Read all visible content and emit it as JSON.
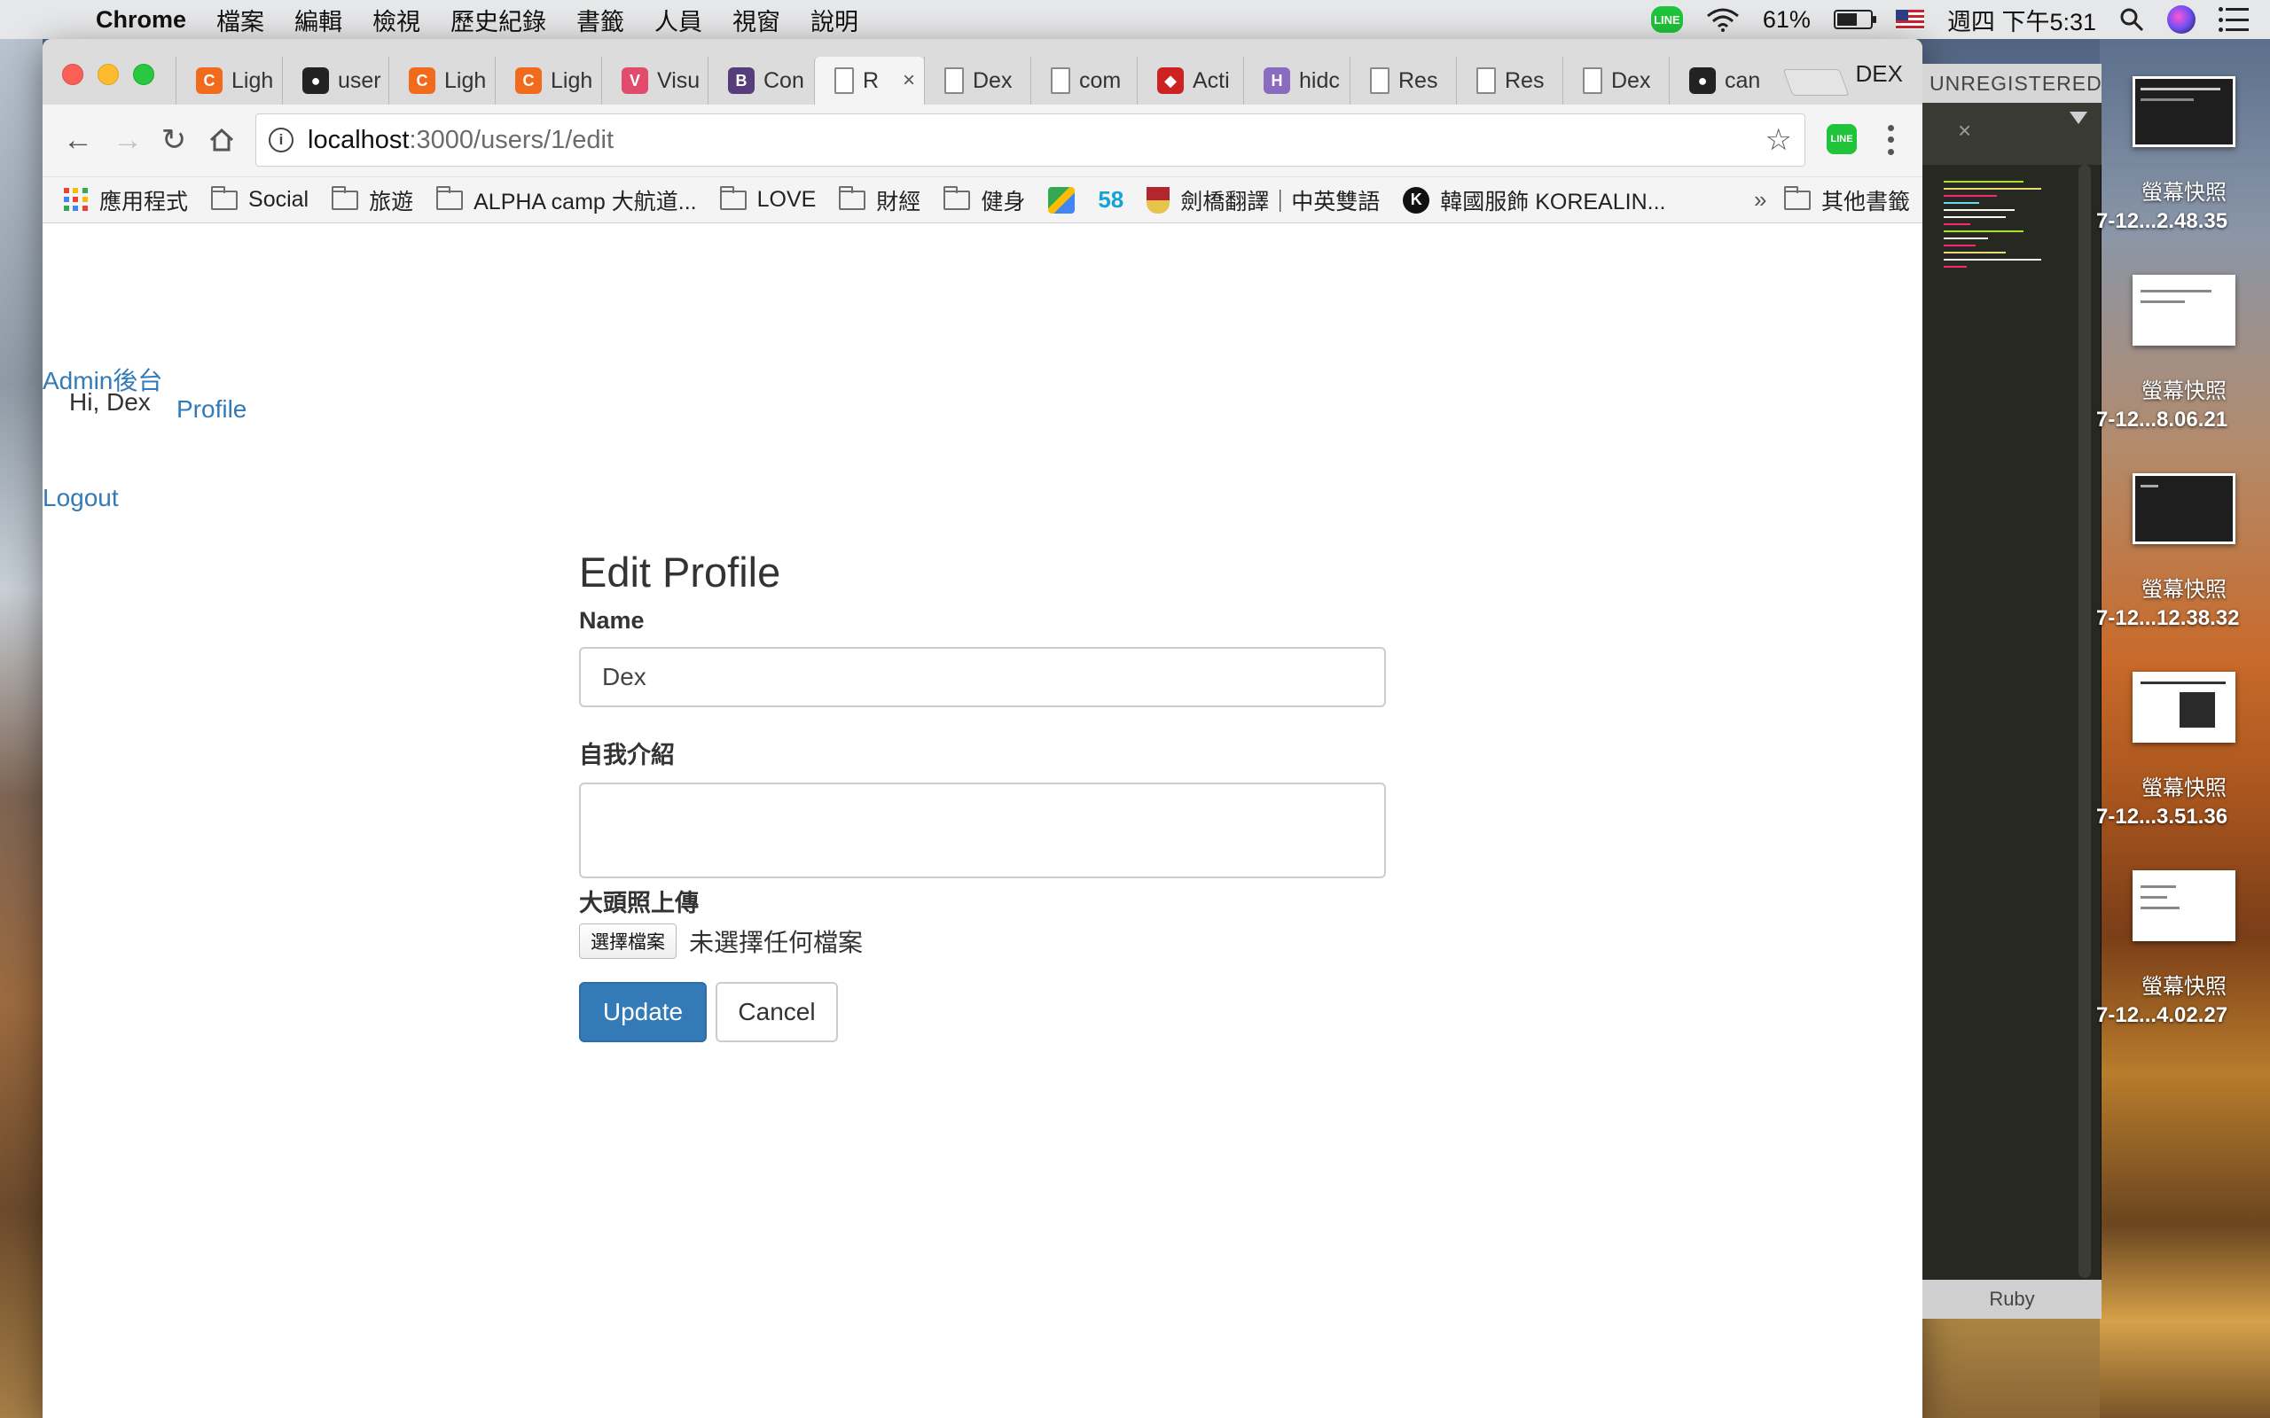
{
  "menubar": {
    "app": "Chrome",
    "items": [
      "檔案",
      "編輯",
      "檢視",
      "歷史紀錄",
      "書籤",
      "人員",
      "視窗",
      "說明"
    ],
    "line_badge": "LINE",
    "battery": "61%",
    "battery_level": 0.61,
    "clock": "週四 下午5:31"
  },
  "browser": {
    "tabs": [
      {
        "label": "Ligh",
        "icon": "orange-c-icon",
        "color": "#f26a1b"
      },
      {
        "label": "user",
        "icon": "github-icon",
        "color": "#222222"
      },
      {
        "label": "Ligh",
        "icon": "orange-c-icon",
        "color": "#f26a1b"
      },
      {
        "label": "Ligh",
        "icon": "orange-c-icon",
        "color": "#f26a1b"
      },
      {
        "label": "Visu",
        "icon": "v-icon",
        "color": "#e24b6b"
      },
      {
        "label": "Con",
        "icon": "bootstrap-icon",
        "color": "#563d7c"
      },
      {
        "label": "R",
        "icon": "page-icon",
        "color": "#888888",
        "active": true
      },
      {
        "label": "Dex",
        "icon": "page-icon",
        "color": "#888888"
      },
      {
        "label": "com",
        "icon": "page-icon",
        "color": "#888888"
      },
      {
        "label": "Acti",
        "icon": "ruby-icon",
        "color": "#cc2222"
      },
      {
        "label": "hidc",
        "icon": "h-icon",
        "color": "#8b6bbf"
      },
      {
        "label": "Res",
        "icon": "page-icon",
        "color": "#888888"
      },
      {
        "label": "Res",
        "icon": "page-icon",
        "color": "#888888"
      },
      {
        "label": "Dex",
        "icon": "page-icon",
        "color": "#888888"
      },
      {
        "label": "can",
        "icon": "github-icon",
        "color": "#222222"
      }
    ],
    "profile": "DEX",
    "url_host": "localhost",
    "url_rest": ":3000/users/1/edit",
    "bookmarks": {
      "apps": "應用程式",
      "social": "Social",
      "travel": "旅遊",
      "alpha": "ALPHA camp 大航道...",
      "love": "LOVE",
      "finance": "財經",
      "fitness": "健身",
      "s58": "58",
      "cambridge": "劍橋翻譯｜中英雙語",
      "korea": "韓國服飾 KOREALIN...",
      "more": "»",
      "other": "其他書籤"
    }
  },
  "page": {
    "admin_link": "Admin後台",
    "greeting": "Hi, Dex",
    "profile_link": "Profile",
    "logout_link": "Logout",
    "form": {
      "title": "Edit Profile",
      "name_label": "Name",
      "name_value": "Dex",
      "intro_label": "自我介紹",
      "intro_value": "",
      "avatar_label": "大頭照上傳",
      "file_button": "選擇檔案",
      "file_status": "未選擇任何檔案",
      "update_button": "Update",
      "cancel_button": "Cancel"
    }
  },
  "sublime": {
    "title": "UNREGISTERED",
    "syntax": "Ruby"
  },
  "desktop": {
    "items": [
      {
        "name": "螢幕快照",
        "sub": "7-12...2.48.35"
      },
      {
        "name": "螢幕快照",
        "sub": "7-12...8.06.21"
      },
      {
        "name": "螢幕快照",
        "sub": "7-12...12.38.32"
      },
      {
        "name": "螢幕快照",
        "sub": "7-12...3.51.36"
      },
      {
        "name": "螢幕快照",
        "sub": "7-12...4.02.27"
      }
    ]
  }
}
